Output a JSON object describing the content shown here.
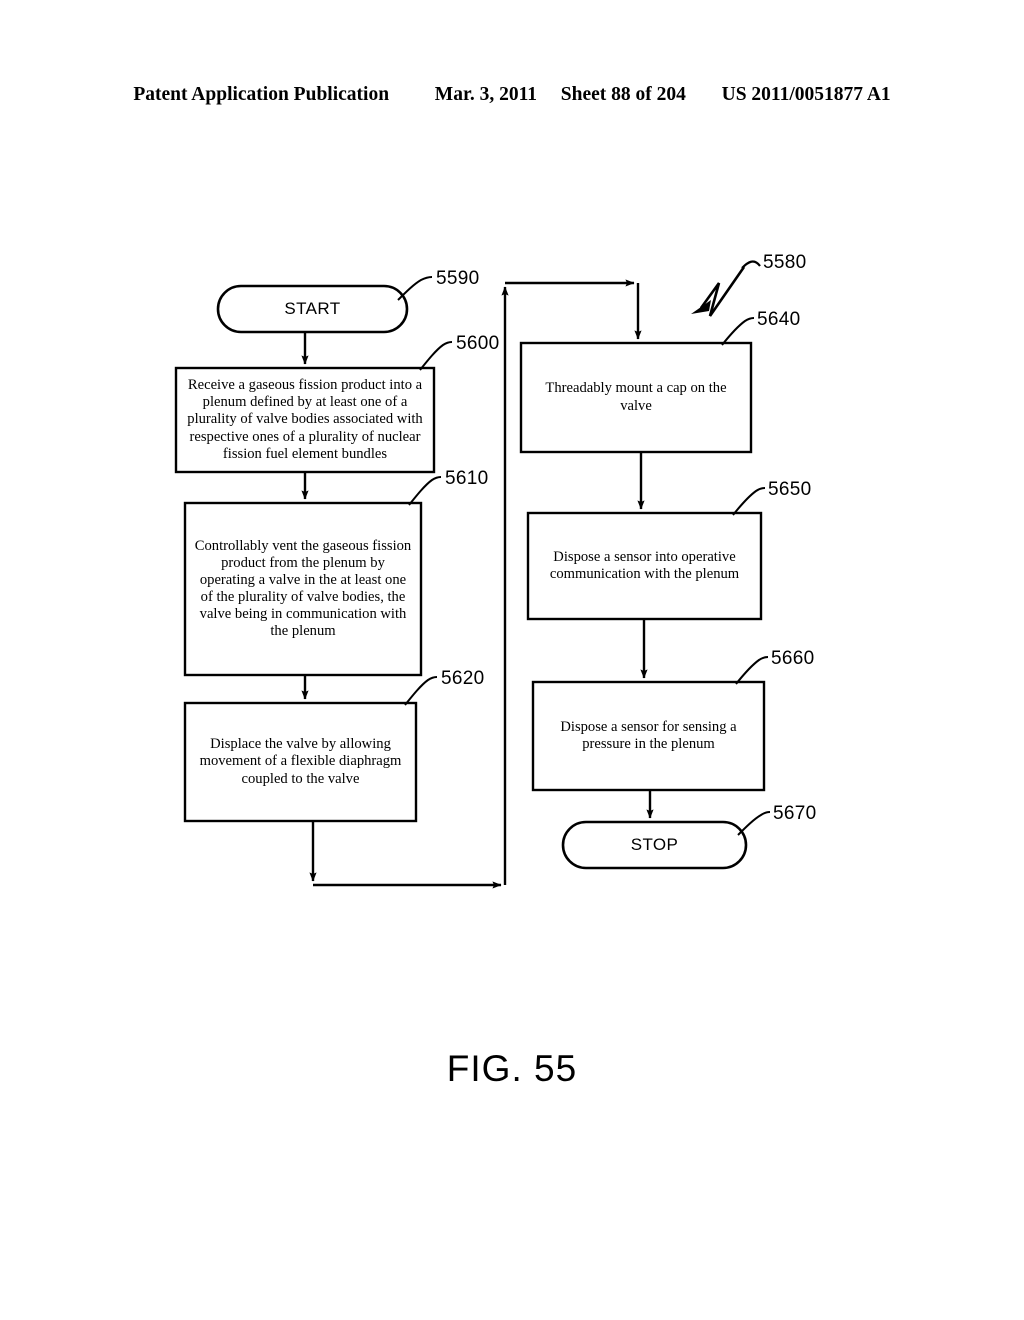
{
  "header": {
    "publication": "Patent Application Publication",
    "date": "Mar. 3, 2011",
    "sheet": "Sheet 88 of 204",
    "pub_number": "US 2011/0051877 A1"
  },
  "figure": {
    "caption": "FIG. 55",
    "diagram_label": "5580",
    "nodes": [
      {
        "id": "5590",
        "type": "terminator",
        "label": "START"
      },
      {
        "id": "5600",
        "type": "process",
        "label": "Receive a gaseous fission product into a plenum defined by at least one of a plurality of valve bodies associated with respective ones of a plurality of nuclear fission fuel element bundles"
      },
      {
        "id": "5610",
        "type": "process",
        "label": "Controllably vent the gaseous fission product from the plenum by operating a valve in the at least one of the plurality of valve bodies, the valve being in communication with the plenum"
      },
      {
        "id": "5620",
        "type": "process",
        "label": "Displace the valve by allowing movement of a flexible diaphragm coupled to the valve"
      },
      {
        "id": "5640",
        "type": "process",
        "label": "Threadably mount a cap on the valve"
      },
      {
        "id": "5650",
        "type": "process",
        "label": "Dispose a sensor into operative communication with the plenum"
      },
      {
        "id": "5660",
        "type": "process",
        "label": "Dispose a sensor for sensing a pressure in the plenum"
      },
      {
        "id": "5670",
        "type": "terminator",
        "label": "STOP"
      }
    ],
    "ref_numerals": [
      "5590",
      "5600",
      "5610",
      "5620",
      "5580",
      "5640",
      "5650",
      "5660",
      "5670"
    ],
    "colors": {
      "ink": "#000000",
      "paper": "#ffffff"
    }
  }
}
